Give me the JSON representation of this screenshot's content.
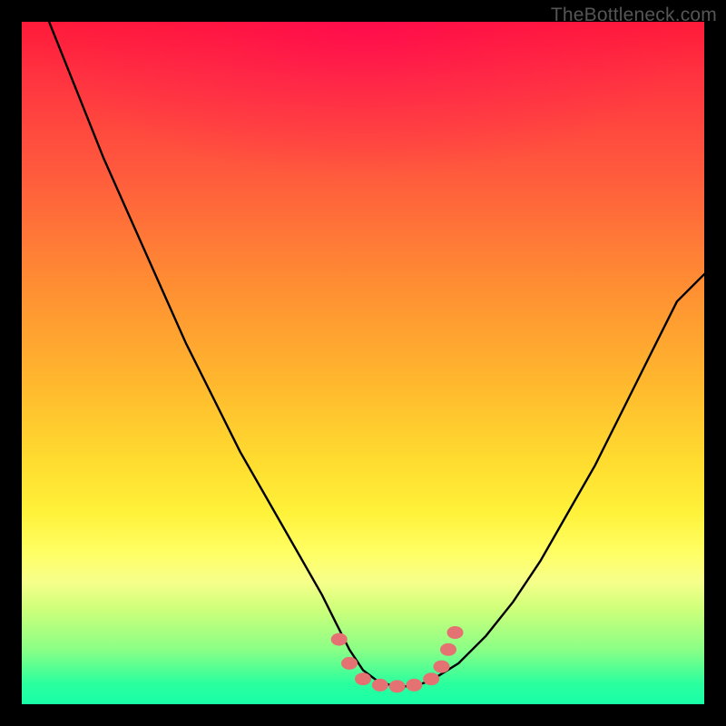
{
  "watermark": "TheBottleneck.com",
  "colors": {
    "frame": "#000000",
    "curve": "#000000",
    "marker": "#e57272",
    "gradient_top": "#ff1a3a",
    "gradient_mid": "#ffdb2f",
    "gradient_bottom": "#19ffa8"
  },
  "chart_data": {
    "type": "line",
    "title": "",
    "xlabel": "",
    "ylabel": "",
    "xlim": [
      0,
      100
    ],
    "ylim": [
      0,
      100
    ],
    "series": [
      {
        "name": "bottleneck-curve",
        "x": [
          4,
          8,
          12,
          16,
          20,
          24,
          28,
          32,
          36,
          40,
          44,
          46,
          48,
          50,
          52,
          54,
          56,
          58,
          60,
          64,
          68,
          72,
          76,
          80,
          84,
          88,
          92,
          96,
          100
        ],
        "y": [
          100,
          90,
          80,
          71,
          62,
          53,
          45,
          37,
          30,
          23,
          16,
          12,
          8,
          5,
          3.5,
          2.8,
          2.6,
          2.8,
          3.5,
          6,
          10,
          15,
          21,
          28,
          35,
          43,
          51,
          59,
          63
        ]
      }
    ],
    "markers": [
      {
        "x": 46.5,
        "y": 9.5
      },
      {
        "x": 48.0,
        "y": 6.0
      },
      {
        "x": 50.0,
        "y": 3.7
      },
      {
        "x": 52.5,
        "y": 2.8
      },
      {
        "x": 55.0,
        "y": 2.6
      },
      {
        "x": 57.5,
        "y": 2.8
      },
      {
        "x": 60.0,
        "y": 3.7
      },
      {
        "x": 61.5,
        "y": 5.5
      },
      {
        "x": 62.5,
        "y": 8.0
      },
      {
        "x": 63.5,
        "y": 10.5
      }
    ]
  }
}
